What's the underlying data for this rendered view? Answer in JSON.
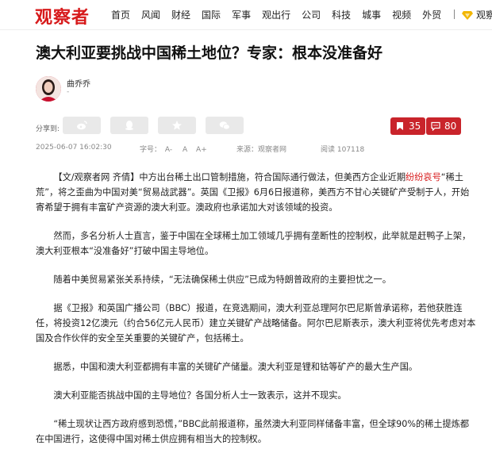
{
  "header": {
    "logo": "观察者",
    "nav": [
      "首页",
      "风闻",
      "财经",
      "国际",
      "军事",
      "观出行",
      "公司",
      "科技",
      "城事",
      "视频",
      "外贸"
    ],
    "vip_label": "观察"
  },
  "article": {
    "title": "澳大利亚要挑战中国稀土地位？专家：根本没准备好",
    "author": "曲乔乔",
    "author_sub": "-",
    "share_label": "分享到:",
    "bookmark_count": "35",
    "comment_count": "80",
    "date": "2025-06-07 16:02:30",
    "font_label": "字号：",
    "font_sizes": [
      "A-",
      "A",
      "A+"
    ],
    "source": "来源：观察者网",
    "reads": "阅读 107118",
    "paragraphs": {
      "p1_pre": "【文/观察者网 齐倩】中方出台稀土出口管制措施，符合国际通行做法，但美西方企业近期",
      "p1_red": "纷纷哀号",
      "p1_post": "“稀土荒”，将之歪曲为中国对美“贸易战武器”。英国《卫报》6月6日报道称，美西方不甘心关键矿产受制于人，开始寄希望于拥有丰富矿产资源的澳大利亚。澳政府也承诺加大对该领域的投资。",
      "p2": "然而，多名分析人士直言，鉴于中国在全球稀土加工领域几乎拥有垄断性的控制权，此举就是赶鸭子上架，澳大利亚根本“没准备好”打破中国主导地位。",
      "p3": "随着中美贸易紧张关系持续，“无法确保稀土供应”已成为特朗普政府的主要担忧之一。",
      "p4": "据《卫报》和英国广播公司（BBC）报道，在竞选期间，澳大利亚总理阿尔巴尼斯曾承诺称，若他获胜连任，将投资12亿澳元（约合56亿元人民币）建立关键矿产战略储备。阿尔巴尼斯表示，澳大利亚将优先考虑对本国及合作伙伴的安全至关重要的关键矿产，包括稀土。",
      "p5": "据悉，中国和澳大利亚都拥有丰富的关键矿产储量。澳大利亚是锂和钴等矿产的最大生产国。",
      "p6": "澳大利亚能否挑战中国的主导地位？各国分析人士一致表示，这并不现实。",
      "p7": "“稀土现状让西方政府感到恐慌，”BBC此前报道称，虽然澳大利亚同样储备丰富，但全球90%的稀土提炼都在中国进行，这使得中国对稀土供应拥有相当大的控制权。"
    }
  },
  "colors": {
    "brand": "#d71a1b",
    "stat": "#c9242b"
  }
}
